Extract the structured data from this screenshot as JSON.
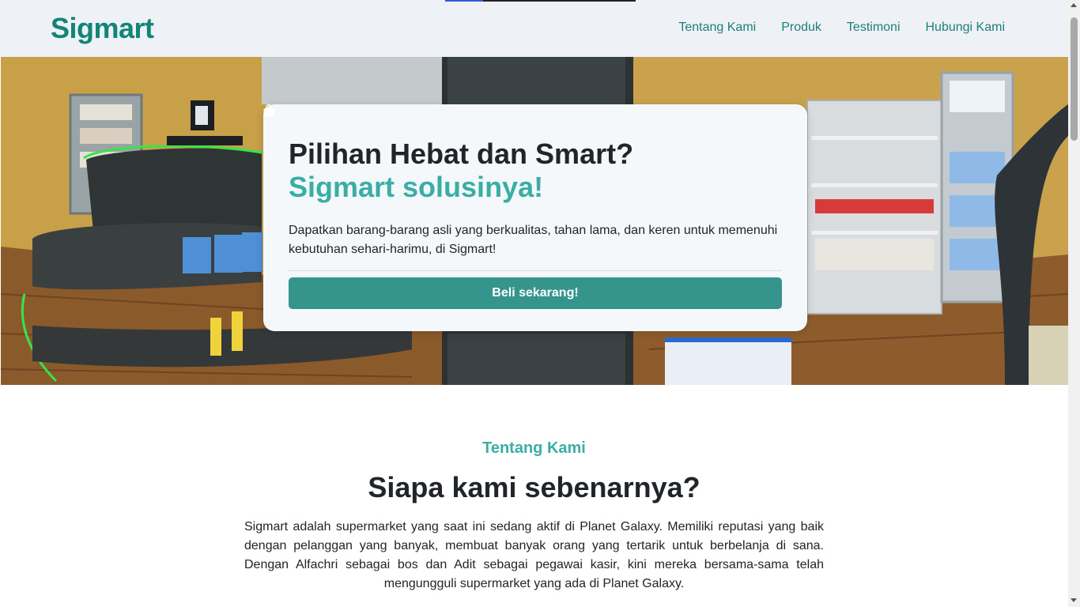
{
  "header": {
    "brand": "Sigmart",
    "nav": [
      "Tentang Kami",
      "Produk",
      "Testimoni",
      "Hubungi Kami"
    ]
  },
  "hero": {
    "title": "Pilihan Hebat dan Smart?",
    "subtitle": "Sigmart solusinya!",
    "description": "Dapatkan barang-barang asli yang berkualitas, tahan lama, dan keren untuk memenuhi kebutuhan sehari-harimu, di Sigmart!",
    "button_label": "Beli sekarang!",
    "button_icon": "shopping-bag-icon",
    "background_image": "supermarket-interior-image"
  },
  "about": {
    "kicker": "Tentang Kami",
    "title": "Siapa kami sebenarnya?",
    "text": "Sigmart adalah supermarket yang saat ini sedang aktif di Planet Galaxy. Memiliki reputasi yang baik dengan pelanggan yang banyak, membuat banyak orang yang tertarik untuk berbelanja di sana. Dengan Alfachri sebagai bos dan Adit sebagai pegawai kasir, kini mereka bersama-sama telah mengungguli supermarket yang ada di Planet Galaxy."
  },
  "colors": {
    "brand": "#128479",
    "accent": "#3aaea4",
    "button": "#35958d",
    "header_bg": "#eef2f6"
  }
}
